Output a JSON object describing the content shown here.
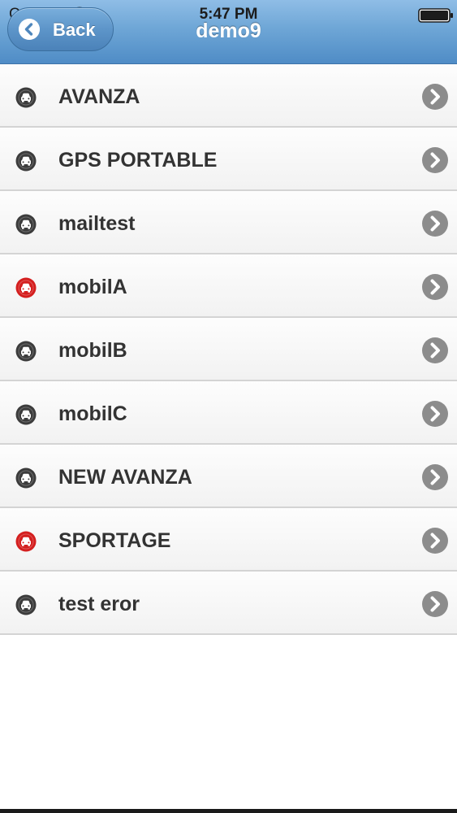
{
  "status_bar": {
    "carrier": "Carrier",
    "time": "5:47 PM"
  },
  "nav": {
    "back_label": "Back",
    "title": "demo9"
  },
  "colors": {
    "header": "#6ea6d6",
    "vehicle_normal": "#3c3c3c",
    "vehicle_alert": "#d41f1f",
    "disclosure": "#8c8c8c"
  },
  "vehicles": [
    {
      "label": "AVANZA",
      "status": "normal",
      "icon": "car-icon"
    },
    {
      "label": "GPS PORTABLE",
      "status": "normal",
      "icon": "car-icon"
    },
    {
      "label": "mailtest",
      "status": "normal",
      "icon": "car-icon"
    },
    {
      "label": "mobilA",
      "status": "alert",
      "icon": "car-icon"
    },
    {
      "label": "mobilB",
      "status": "normal",
      "icon": "car-icon"
    },
    {
      "label": "mobilC",
      "status": "normal",
      "icon": "car-icon"
    },
    {
      "label": "NEW AVANZA",
      "status": "normal",
      "icon": "car-icon"
    },
    {
      "label": "SPORTAGE",
      "status": "alert",
      "icon": "car-icon"
    },
    {
      "label": "test eror",
      "status": "normal",
      "icon": "car-icon"
    }
  ]
}
